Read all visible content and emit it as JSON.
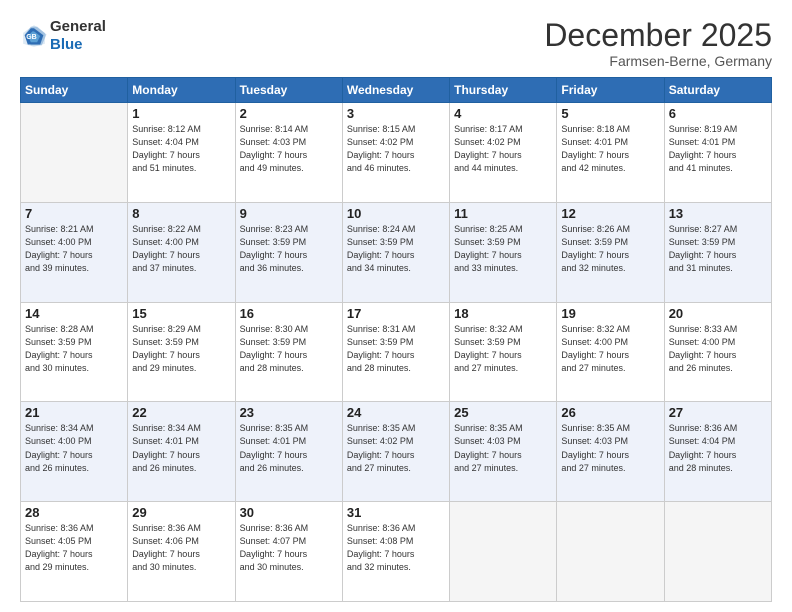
{
  "header": {
    "logo_line1": "General",
    "logo_line2": "Blue",
    "month": "December 2025",
    "location": "Farmsen-Berne, Germany"
  },
  "weekdays": [
    "Sunday",
    "Monday",
    "Tuesday",
    "Wednesday",
    "Thursday",
    "Friday",
    "Saturday"
  ],
  "weeks": [
    [
      {
        "day": "",
        "detail": ""
      },
      {
        "day": "1",
        "detail": "Sunrise: 8:12 AM\nSunset: 4:04 PM\nDaylight: 7 hours\nand 51 minutes."
      },
      {
        "day": "2",
        "detail": "Sunrise: 8:14 AM\nSunset: 4:03 PM\nDaylight: 7 hours\nand 49 minutes."
      },
      {
        "day": "3",
        "detail": "Sunrise: 8:15 AM\nSunset: 4:02 PM\nDaylight: 7 hours\nand 46 minutes."
      },
      {
        "day": "4",
        "detail": "Sunrise: 8:17 AM\nSunset: 4:02 PM\nDaylight: 7 hours\nand 44 minutes."
      },
      {
        "day": "5",
        "detail": "Sunrise: 8:18 AM\nSunset: 4:01 PM\nDaylight: 7 hours\nand 42 minutes."
      },
      {
        "day": "6",
        "detail": "Sunrise: 8:19 AM\nSunset: 4:01 PM\nDaylight: 7 hours\nand 41 minutes."
      }
    ],
    [
      {
        "day": "7",
        "detail": "Sunrise: 8:21 AM\nSunset: 4:00 PM\nDaylight: 7 hours\nand 39 minutes."
      },
      {
        "day": "8",
        "detail": "Sunrise: 8:22 AM\nSunset: 4:00 PM\nDaylight: 7 hours\nand 37 minutes."
      },
      {
        "day": "9",
        "detail": "Sunrise: 8:23 AM\nSunset: 3:59 PM\nDaylight: 7 hours\nand 36 minutes."
      },
      {
        "day": "10",
        "detail": "Sunrise: 8:24 AM\nSunset: 3:59 PM\nDaylight: 7 hours\nand 34 minutes."
      },
      {
        "day": "11",
        "detail": "Sunrise: 8:25 AM\nSunset: 3:59 PM\nDaylight: 7 hours\nand 33 minutes."
      },
      {
        "day": "12",
        "detail": "Sunrise: 8:26 AM\nSunset: 3:59 PM\nDaylight: 7 hours\nand 32 minutes."
      },
      {
        "day": "13",
        "detail": "Sunrise: 8:27 AM\nSunset: 3:59 PM\nDaylight: 7 hours\nand 31 minutes."
      }
    ],
    [
      {
        "day": "14",
        "detail": "Sunrise: 8:28 AM\nSunset: 3:59 PM\nDaylight: 7 hours\nand 30 minutes."
      },
      {
        "day": "15",
        "detail": "Sunrise: 8:29 AM\nSunset: 3:59 PM\nDaylight: 7 hours\nand 29 minutes."
      },
      {
        "day": "16",
        "detail": "Sunrise: 8:30 AM\nSunset: 3:59 PM\nDaylight: 7 hours\nand 28 minutes."
      },
      {
        "day": "17",
        "detail": "Sunrise: 8:31 AM\nSunset: 3:59 PM\nDaylight: 7 hours\nand 28 minutes."
      },
      {
        "day": "18",
        "detail": "Sunrise: 8:32 AM\nSunset: 3:59 PM\nDaylight: 7 hours\nand 27 minutes."
      },
      {
        "day": "19",
        "detail": "Sunrise: 8:32 AM\nSunset: 4:00 PM\nDaylight: 7 hours\nand 27 minutes."
      },
      {
        "day": "20",
        "detail": "Sunrise: 8:33 AM\nSunset: 4:00 PM\nDaylight: 7 hours\nand 26 minutes."
      }
    ],
    [
      {
        "day": "21",
        "detail": "Sunrise: 8:34 AM\nSunset: 4:00 PM\nDaylight: 7 hours\nand 26 minutes."
      },
      {
        "day": "22",
        "detail": "Sunrise: 8:34 AM\nSunset: 4:01 PM\nDaylight: 7 hours\nand 26 minutes."
      },
      {
        "day": "23",
        "detail": "Sunrise: 8:35 AM\nSunset: 4:01 PM\nDaylight: 7 hours\nand 26 minutes."
      },
      {
        "day": "24",
        "detail": "Sunrise: 8:35 AM\nSunset: 4:02 PM\nDaylight: 7 hours\nand 27 minutes."
      },
      {
        "day": "25",
        "detail": "Sunrise: 8:35 AM\nSunset: 4:03 PM\nDaylight: 7 hours\nand 27 minutes."
      },
      {
        "day": "26",
        "detail": "Sunrise: 8:35 AM\nSunset: 4:03 PM\nDaylight: 7 hours\nand 27 minutes."
      },
      {
        "day": "27",
        "detail": "Sunrise: 8:36 AM\nSunset: 4:04 PM\nDaylight: 7 hours\nand 28 minutes."
      }
    ],
    [
      {
        "day": "28",
        "detail": "Sunrise: 8:36 AM\nSunset: 4:05 PM\nDaylight: 7 hours\nand 29 minutes."
      },
      {
        "day": "29",
        "detail": "Sunrise: 8:36 AM\nSunset: 4:06 PM\nDaylight: 7 hours\nand 30 minutes."
      },
      {
        "day": "30",
        "detail": "Sunrise: 8:36 AM\nSunset: 4:07 PM\nDaylight: 7 hours\nand 30 minutes."
      },
      {
        "day": "31",
        "detail": "Sunrise: 8:36 AM\nSunset: 4:08 PM\nDaylight: 7 hours\nand 32 minutes."
      },
      {
        "day": "",
        "detail": ""
      },
      {
        "day": "",
        "detail": ""
      },
      {
        "day": "",
        "detail": ""
      }
    ]
  ]
}
